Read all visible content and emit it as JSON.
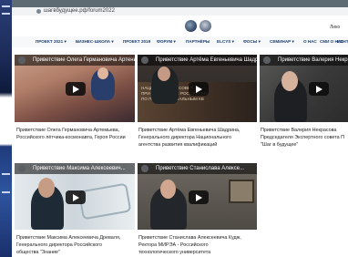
{
  "browser": {
    "url": "шагвбудущее.рф/forum2022"
  },
  "header": {
    "user_name": "Лико"
  },
  "nav": {
    "items": [
      "ПРОЕКТ 2021 ▾",
      "БИЗНЕС-ШКОЛА ▾",
      "ПРОЕКТ 2019",
      "ФОРУМ ▾",
      "ПАРТНЁРЫ",
      "ELCYS ▾",
      "ФОСЫ ▾",
      "СЕМИНАР ▾",
      "О НАС",
      "СМИ О НАС",
      "КОНТ"
    ]
  },
  "videos": [
    {
      "overlay_title": "Приветствие Олега Германовича Артеньева...",
      "caption_line1": "Приветствие Олега Германовича Артемьева,",
      "caption_line2": "Российского лётчика-космонавта, Героя России"
    },
    {
      "overlay_title": "Приветствие Артёма Евгеньевича Шадрина...",
      "caption_line1": "Приветствие Артёма Евгеньевича Шадрина,",
      "caption_line2": "Генерального директора Национального",
      "caption_line3": "агентства развития квалификаций",
      "thumb_text1": "НАЦИОНАЛЬНЫЙ СОВЕТ",
      "thumb_text2": "ПРИ ПРЕЗИДЕНТЕ РОССИЙСКО",
      "thumb_text3": "ПО ПРОФЕССИОНАЛЬНЫМ КВ"
    },
    {
      "overlay_title": "Приветствие Валерия Некрасова",
      "caption_line1": "Приветствие Валерия Некрасова",
      "caption_line2": "Председателя Экспертного совета П",
      "caption_line3": "\"Шаг в будущее\""
    },
    {
      "overlay_title": "Приветствие Максима Алексеевич...",
      "caption_line1": "Приветствие Максима Алексеевича Древаля,",
      "caption_line2": "Генерального директора Российского",
      "caption_line3": "общества \"Знание\""
    },
    {
      "overlay_title": "Приветствие Станислава Алексе...",
      "caption_line1": "Приветствие Станислава Алексеевича Кудж,",
      "caption_line2": "Ректора МИРЭА - Российского",
      "caption_line3": "технологического университета"
    }
  ]
}
